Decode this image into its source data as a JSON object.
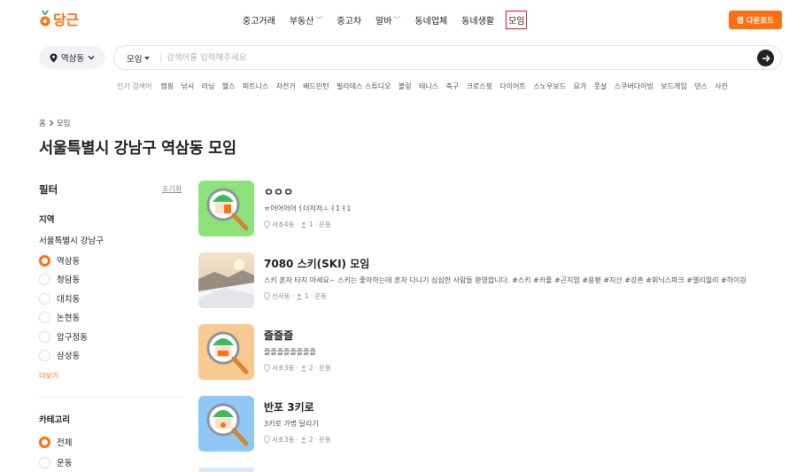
{
  "header": {
    "logo_text": "당근",
    "nav": [
      {
        "label": "중고거래",
        "dropdown": false,
        "active": false
      },
      {
        "label": "부동산",
        "dropdown": true,
        "active": false
      },
      {
        "label": "중고차",
        "dropdown": false,
        "active": false
      },
      {
        "label": "알바",
        "dropdown": true,
        "active": false
      },
      {
        "label": "동네업체",
        "dropdown": false,
        "active": false
      },
      {
        "label": "동네생활",
        "dropdown": false,
        "active": false
      },
      {
        "label": "모임",
        "dropdown": false,
        "active": true
      }
    ],
    "download_label": "앱 다운로드"
  },
  "search": {
    "location": "역삼동",
    "category": "모임",
    "placeholder": "검색어를 입력해주세요",
    "value": ""
  },
  "popular": {
    "label": "인기 검색어",
    "keywords": [
      "캠핑",
      "낚시",
      "러닝",
      "헬스",
      "피트니스",
      "자전거",
      "배드민턴",
      "필라테스 스튜디오",
      "볼링",
      "테니스",
      "축구",
      "크로스핏",
      "다이어트",
      "스노우보드",
      "요가",
      "풋살",
      "스쿠버다이빙",
      "보드게임",
      "댄스",
      "사진"
    ]
  },
  "breadcrumb": {
    "home": "홈",
    "current": "모임"
  },
  "page_title": "서울특별시 강남구 역삼동 모임",
  "filter": {
    "title": "필터",
    "reset": "초기화",
    "region_title": "지역",
    "region_name": "서울특별시 강남구",
    "neighborhoods": [
      {
        "label": "역삼동",
        "selected": true
      },
      {
        "label": "청담동",
        "selected": false
      },
      {
        "label": "대치동",
        "selected": false
      },
      {
        "label": "논현동",
        "selected": false
      },
      {
        "label": "압구정동",
        "selected": false
      },
      {
        "label": "삼성동",
        "selected": false
      }
    ],
    "more": "더보기",
    "category_title": "카테고리",
    "categories": [
      {
        "label": "전체",
        "selected": true
      },
      {
        "label": "운동",
        "selected": false
      }
    ]
  },
  "groups": [
    {
      "title": "ㅇㅇㅇ",
      "desc": "ㅠ어어어어ㅓ더저저ㅗㅕ1ㅕ1",
      "location": "서초4동",
      "members": "1",
      "category": "운동",
      "thumb_bg": "#8ee27a"
    },
    {
      "title": "7080 스키(SKI) 모임",
      "desc": "스키 혼자 타지 마세요~ 스키는 좋아하는데 혼자 다니기 심심한 사람들 환영합니다. #스키 #카풀 #곤지암 #용평 #지산 #강촌 #휘닉스파크 #엘리힐리 #하이원",
      "location": "신사동",
      "members": "1",
      "category": "운동",
      "thumb_bg": "#e9d9c3"
    },
    {
      "title": "즐즐즐",
      "desc": "즐즐즐즐즐즐즐즐",
      "location": "서초3동",
      "members": "2",
      "category": "운동",
      "thumb_bg": "#f9c98f"
    },
    {
      "title": "반포 3키로",
      "desc": "3키로 가볍 달리기",
      "location": "서초3동",
      "members": "2",
      "category": "운동",
      "thumb_bg": "#8fc8f4"
    }
  ],
  "colors": {
    "brand": "#ff6f0f",
    "text": "#212124",
    "muted": "#868b94",
    "active_outline": "#e0141e"
  }
}
